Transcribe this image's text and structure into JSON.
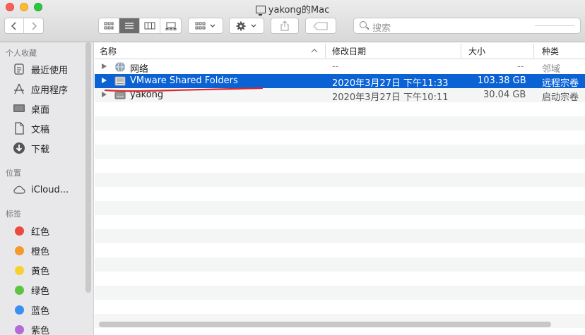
{
  "window": {
    "title": "yakong的Mac"
  },
  "toolbar": {
    "search_placeholder": "搜索"
  },
  "sidebar": {
    "sections": {
      "favorites": "个人收藏",
      "locations": "位置",
      "tags": "标签"
    },
    "favorites": [
      "最近使用",
      "应用程序",
      "桌面",
      "文稿",
      "下载"
    ],
    "locations": [
      "iCloud..."
    ],
    "tags": [
      {
        "label": "红色",
        "color": "#ec4a3e"
      },
      {
        "label": "橙色",
        "color": "#f49a2c"
      },
      {
        "label": "黄色",
        "color": "#f9d032"
      },
      {
        "label": "绿色",
        "color": "#5bc541"
      },
      {
        "label": "蓝色",
        "color": "#3b8ff3"
      },
      {
        "label": "紫色",
        "color": "#b46bd5"
      }
    ]
  },
  "list": {
    "columns": [
      "名称",
      "修改日期",
      "大小",
      "种类"
    ],
    "rows": [
      {
        "name": "网络",
        "date": "--",
        "size": "--",
        "kind": "邻域"
      },
      {
        "name": "VMware Shared Folders",
        "date": "2020年3月27日 下午11:33",
        "size": "103.38 GB",
        "kind": "远程宗卷"
      },
      {
        "name": "yakong",
        "date": "2020年3月27日 下午10:11",
        "size": "30.04 GB",
        "kind": "启动宗卷"
      }
    ]
  },
  "colors": {
    "selection": "#0a62d4",
    "annotation": "#d9282f"
  }
}
